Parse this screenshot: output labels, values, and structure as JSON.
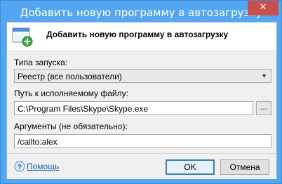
{
  "window": {
    "title": "Добавить новую программу в автозагрузку",
    "close_glyph": "✕",
    "accent_color": "#55a6f0",
    "close_color": "#c7504d"
  },
  "header": {
    "title": "Добавить новую программу в автозагрузку",
    "icon": "window-add-icon"
  },
  "form": {
    "launch_type": {
      "label": "Типа запуска:",
      "value": "Реестр (все пользователи)"
    },
    "path": {
      "label": "Путь к исполняемому файлу:",
      "value": "C:\\Program Files\\Skype\\Skype.exe",
      "browse_label": "..."
    },
    "args": {
      "label": "Аргументы (не обязательно):",
      "value": "/callto:alex"
    }
  },
  "footer": {
    "help_label": "Помощь",
    "ok_label": "OK",
    "cancel_label": "Отмена"
  }
}
